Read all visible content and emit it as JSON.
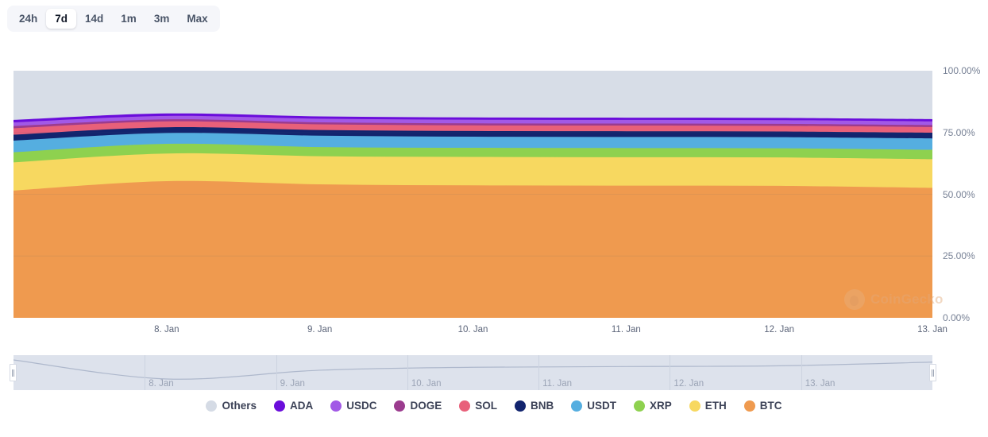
{
  "range_selector": {
    "options": [
      {
        "label": "24h",
        "active": false
      },
      {
        "label": "7d",
        "active": true
      },
      {
        "label": "14d",
        "active": false
      },
      {
        "label": "1m",
        "active": false
      },
      {
        "label": "3m",
        "active": false
      },
      {
        "label": "Max",
        "active": false
      }
    ]
  },
  "watermark": {
    "text": "CoinGecko"
  },
  "navigator": {
    "x_labels": [
      "8. Jan",
      "9. Jan",
      "10. Jan",
      "11. Jan",
      "12. Jan",
      "13. Jan"
    ],
    "left_handle": "nav-handle-left",
    "right_handle": "nav-handle-right"
  },
  "chart_data": {
    "type": "area",
    "stacked": true,
    "normalized_percent": true,
    "title": "",
    "xlabel": "",
    "ylabel": "",
    "ylim": [
      0,
      100
    ],
    "y_ticks": [
      0,
      25,
      50,
      75,
      100
    ],
    "y_tick_labels": [
      "0.00%",
      "25.00%",
      "50.00%",
      "75.00%",
      "100.00%"
    ],
    "grid": true,
    "legend_position": "bottom",
    "x_tick_labels": [
      "8. Jan",
      "9. Jan",
      "10. Jan",
      "11. Jan",
      "12. Jan",
      "13. Jan"
    ],
    "x": [
      "7. Jan",
      "8. Jan",
      "9. Jan",
      "10. Jan",
      "11. Jan",
      "12. Jan",
      "13. Jan"
    ],
    "stack_order_bottom_to_top": [
      "BTC",
      "ETH",
      "XRP",
      "USDT",
      "BNB",
      "SOL",
      "DOGE",
      "USDC",
      "ADA",
      "Others"
    ],
    "series": [
      {
        "name": "BTC",
        "color": "#ef9a4f",
        "values": [
          51.5,
          55.3,
          54.0,
          53.6,
          53.5,
          53.4,
          52.6
        ]
      },
      {
        "name": "ETH",
        "color": "#f7d860",
        "values": [
          11.4,
          11.2,
          11.4,
          11.5,
          11.5,
          11.5,
          11.6
        ]
      },
      {
        "name": "XRP",
        "color": "#8ed14f",
        "values": [
          4.1,
          3.9,
          3.7,
          3.7,
          3.7,
          3.7,
          3.8
        ]
      },
      {
        "name": "USDT",
        "color": "#55aee0",
        "values": [
          4.7,
          4.4,
          4.6,
          4.5,
          4.5,
          4.5,
          4.6
        ]
      },
      {
        "name": "BNB",
        "color": "#12246e",
        "values": [
          2.4,
          2.3,
          2.3,
          2.3,
          2.3,
          2.3,
          2.3
        ]
      },
      {
        "name": "SOL",
        "color": "#e8607a",
        "values": [
          2.6,
          2.4,
          2.3,
          2.3,
          2.3,
          2.3,
          2.3
        ]
      },
      {
        "name": "DOGE",
        "color": "#9b3b8e",
        "values": [
          0.9,
          0.8,
          0.8,
          0.8,
          0.8,
          0.8,
          0.8
        ]
      },
      {
        "name": "USDC",
        "color": "#a259e6",
        "values": [
          1.5,
          1.4,
          1.5,
          1.5,
          1.5,
          1.5,
          1.5
        ]
      },
      {
        "name": "ADA",
        "color": "#6a0ddb",
        "values": [
          1.0,
          1.0,
          0.9,
          0.9,
          0.9,
          0.9,
          0.9
        ]
      },
      {
        "name": "Others",
        "color": "#d7dde7",
        "values": [
          19.9,
          17.3,
          18.5,
          18.9,
          19.0,
          19.1,
          19.6
        ]
      }
    ],
    "legend": [
      {
        "label": "Others",
        "color": "#d5dbe5"
      },
      {
        "label": "ADA",
        "color": "#6a0ddb"
      },
      {
        "label": "USDC",
        "color": "#a259e6"
      },
      {
        "label": "DOGE",
        "color": "#9b3b8e"
      },
      {
        "label": "SOL",
        "color": "#e8607a"
      },
      {
        "label": "BNB",
        "color": "#12246e"
      },
      {
        "label": "USDT",
        "color": "#55aee0"
      },
      {
        "label": "XRP",
        "color": "#8ed14f"
      },
      {
        "label": "ETH",
        "color": "#f7d860"
      },
      {
        "label": "BTC",
        "color": "#ef9a4f"
      }
    ]
  }
}
